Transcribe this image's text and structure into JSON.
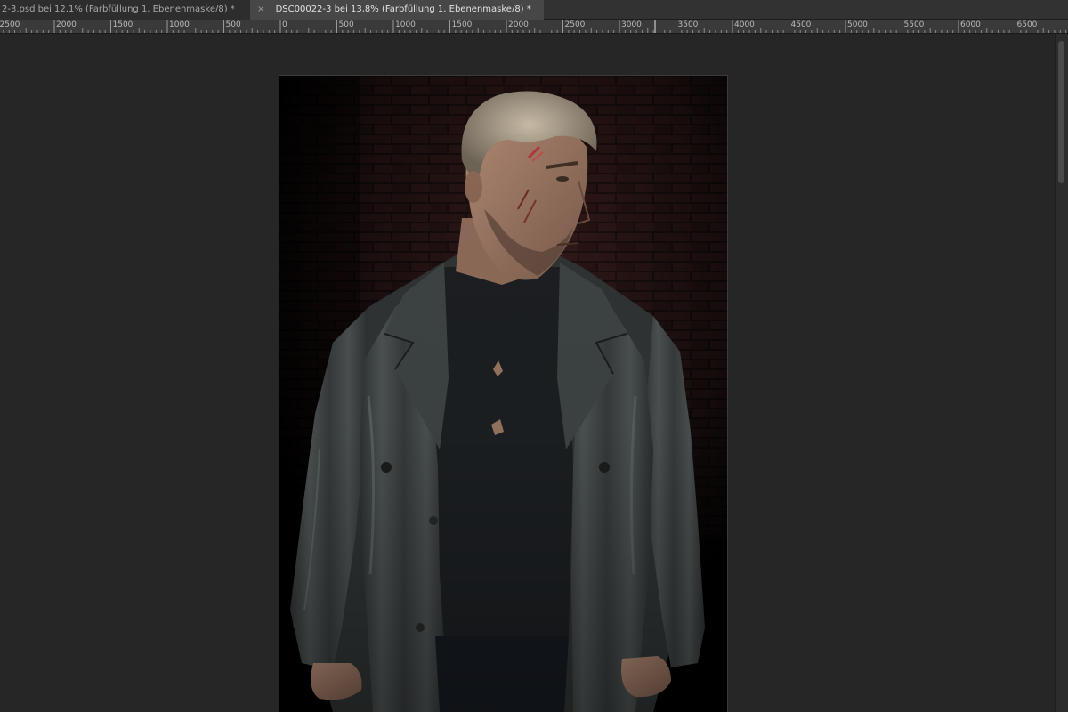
{
  "tabs": [
    {
      "label": "2-3.psd bei 12,1% (Farbfüllung 1, Ebenenmaske/8) *",
      "active": false
    },
    {
      "close_glyph": "×",
      "label": "DSC00022-3 bei 13,8% (Farbfüllung 1, Ebenenmaske/8) *",
      "active": true
    }
  ],
  "ruler": {
    "labels": [
      "2500",
      "2000",
      "1500",
      "1000",
      "500",
      "0",
      "500",
      "1000",
      "1500",
      "2000",
      "2500",
      "3000",
      "3500",
      "4000",
      "4500",
      "5000",
      "5500",
      "6000",
      "6500"
    ]
  },
  "canvas": {
    "image": "photo of a bearded man in a black leather trench coat in front of a dark brick wall",
    "background_color": "#262626"
  },
  "colors": {
    "tabbar": "#323232",
    "active_tab": "#474747",
    "ruler": "#3a3a3a",
    "workspace": "#262626"
  }
}
